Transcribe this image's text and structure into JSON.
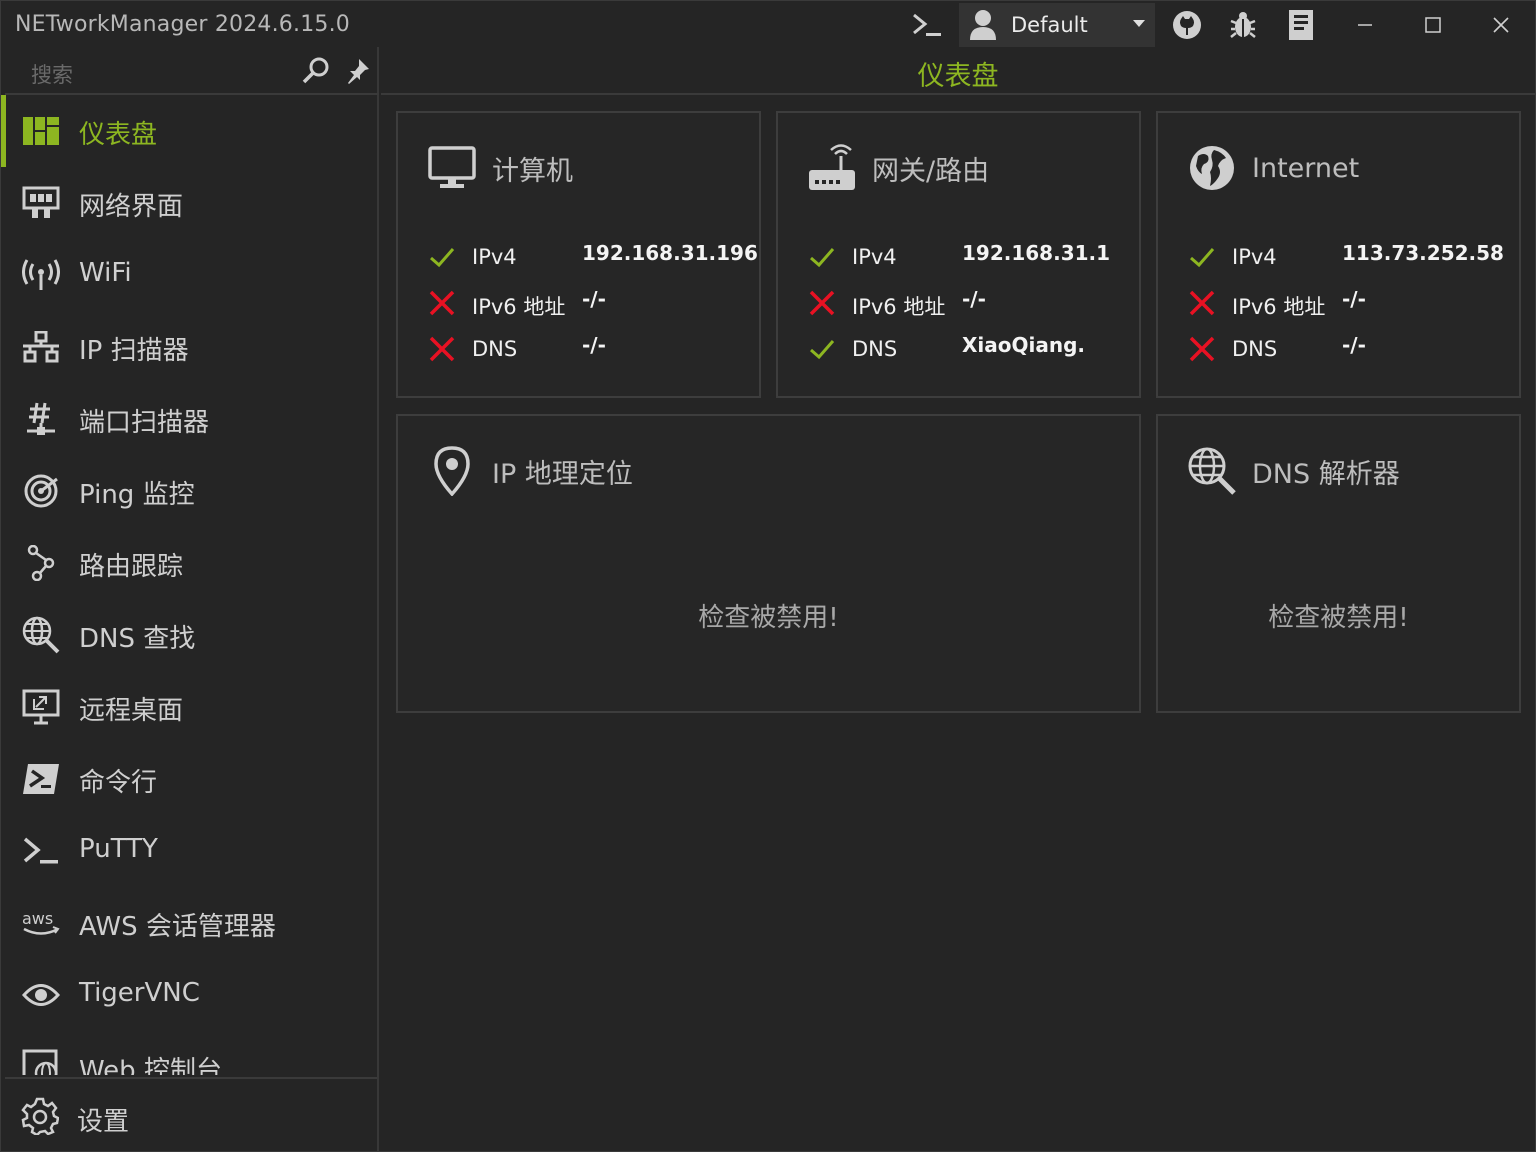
{
  "window": {
    "title": "NETworkManager 2024.6.15.0",
    "profile": "Default",
    "icons": [
      "terminal-icon",
      "user-icon",
      "github-icon",
      "bug-icon",
      "document-icon"
    ],
    "controls": [
      "minimize-icon",
      "maximize-icon",
      "close-icon"
    ]
  },
  "sidebar": {
    "search_placeholder": "搜索",
    "items": [
      {
        "label": "仪表盘",
        "icon": "dashboard-icon",
        "active": true
      },
      {
        "label": "网络界面",
        "icon": "network-interface-icon"
      },
      {
        "label": "WiFi",
        "icon": "wifi-icon"
      },
      {
        "label": "IP 扫描器",
        "icon": "ip-scanner-icon"
      },
      {
        "label": "端口扫描器",
        "icon": "port-scanner-icon"
      },
      {
        "label": "Ping 监控",
        "icon": "ping-monitor-icon"
      },
      {
        "label": "路由跟踪",
        "icon": "traceroute-icon"
      },
      {
        "label": "DNS 查找",
        "icon": "dns-lookup-icon"
      },
      {
        "label": "远程桌面",
        "icon": "remote-desktop-icon"
      },
      {
        "label": "命令行",
        "icon": "powershell-icon"
      },
      {
        "label": "PuTTY",
        "icon": "terminal-icon"
      },
      {
        "label": "AWS 会话管理器",
        "icon": "aws-icon"
      },
      {
        "label": "TigerVNC",
        "icon": "eye-icon"
      },
      {
        "label": "Web 控制台",
        "icon": "web-console-icon"
      }
    ],
    "settings_label": "设置"
  },
  "main": {
    "title": "仪表盘",
    "cards": {
      "computer": {
        "title": "计算机",
        "rows": [
          {
            "label": "IPv4",
            "value": "192.168.31.196",
            "ok": true
          },
          {
            "label": "IPv6 地址",
            "value": "-/-",
            "ok": false
          },
          {
            "label": "DNS",
            "value": "-/-",
            "ok": false
          }
        ]
      },
      "gateway": {
        "title": "网关/路由",
        "rows": [
          {
            "label": "IPv4",
            "value": "192.168.31.1",
            "ok": true
          },
          {
            "label": "IPv6 地址",
            "value": "-/-",
            "ok": false
          },
          {
            "label": "DNS",
            "value": "XiaoQiang.",
            "ok": true
          }
        ]
      },
      "internet": {
        "title": "Internet",
        "rows": [
          {
            "label": "IPv4",
            "value": "113.73.252.58",
            "ok": true
          },
          {
            "label": "IPv6 地址",
            "value": "-/-",
            "ok": false
          },
          {
            "label": "DNS",
            "value": "-/-",
            "ok": false
          }
        ]
      },
      "geolocation": {
        "title": "IP 地理定位",
        "message": "检查被禁用!"
      },
      "dns_resolver": {
        "title": "DNS 解析器",
        "message": "检查被禁用!"
      }
    }
  },
  "colors": {
    "accent": "#8db621",
    "ok": "#8db621",
    "error": "#e81123",
    "background": "#252525"
  }
}
